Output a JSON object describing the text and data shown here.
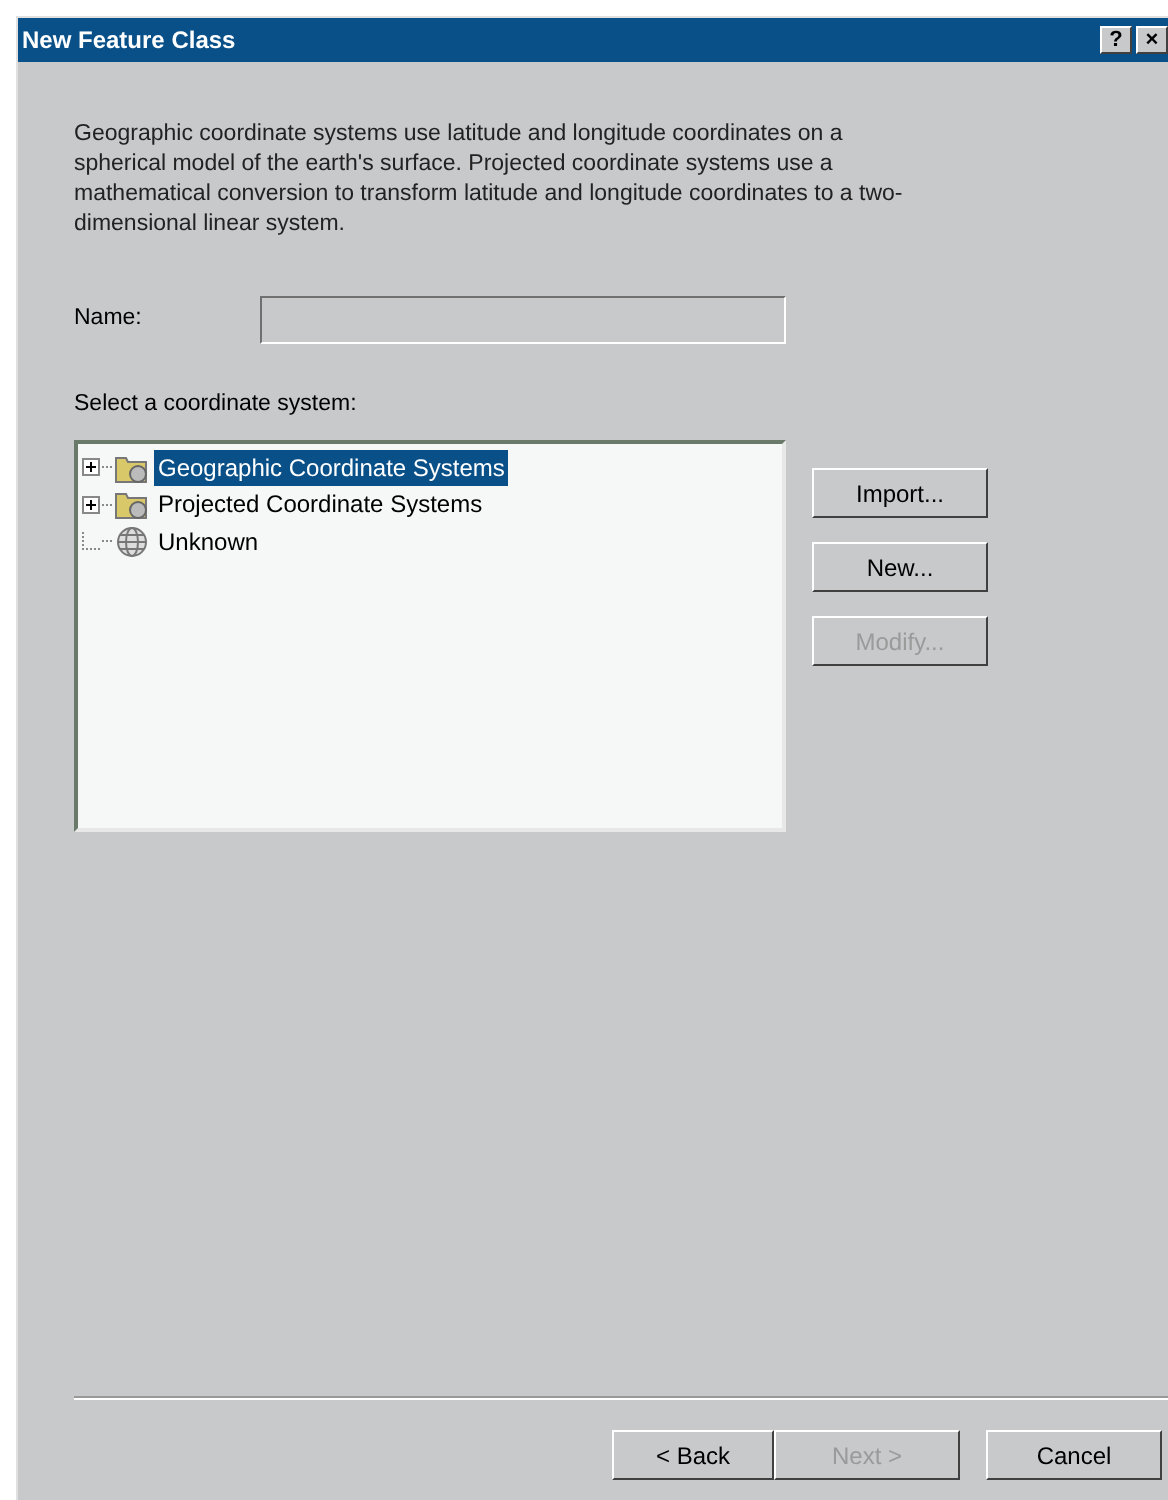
{
  "window": {
    "title": "New Feature Class",
    "help_button": "?",
    "close_button": "×"
  },
  "description": "Geographic coordinate systems use latitude and longitude coordinates on a spherical model of the earth's surface. Projected coordinate systems use a mathematical conversion to transform latitude and longitude coordinates to a two-dimensional linear system.",
  "name_field": {
    "label": "Name:",
    "disabled": true
  },
  "tree_label": "Select a coordinate system:",
  "tree": [
    {
      "label": "Geographic Coordinate Systems",
      "kind": "folder",
      "expanded": false,
      "selected": true
    },
    {
      "label": "Projected Coordinate Systems",
      "kind": "folder",
      "expanded": false,
      "selected": false
    },
    {
      "label": "Unknown",
      "kind": "globe",
      "selected": false
    }
  ],
  "side_buttons": [
    {
      "label": "Import...",
      "disabled": false
    },
    {
      "label": "New...",
      "disabled": false
    },
    {
      "label": "Modify...",
      "disabled": true
    }
  ],
  "footer_buttons": [
    {
      "label": "< Back",
      "disabled": false
    },
    {
      "label": "Next >",
      "disabled": true
    },
    {
      "label": "Cancel",
      "disabled": false
    }
  ]
}
